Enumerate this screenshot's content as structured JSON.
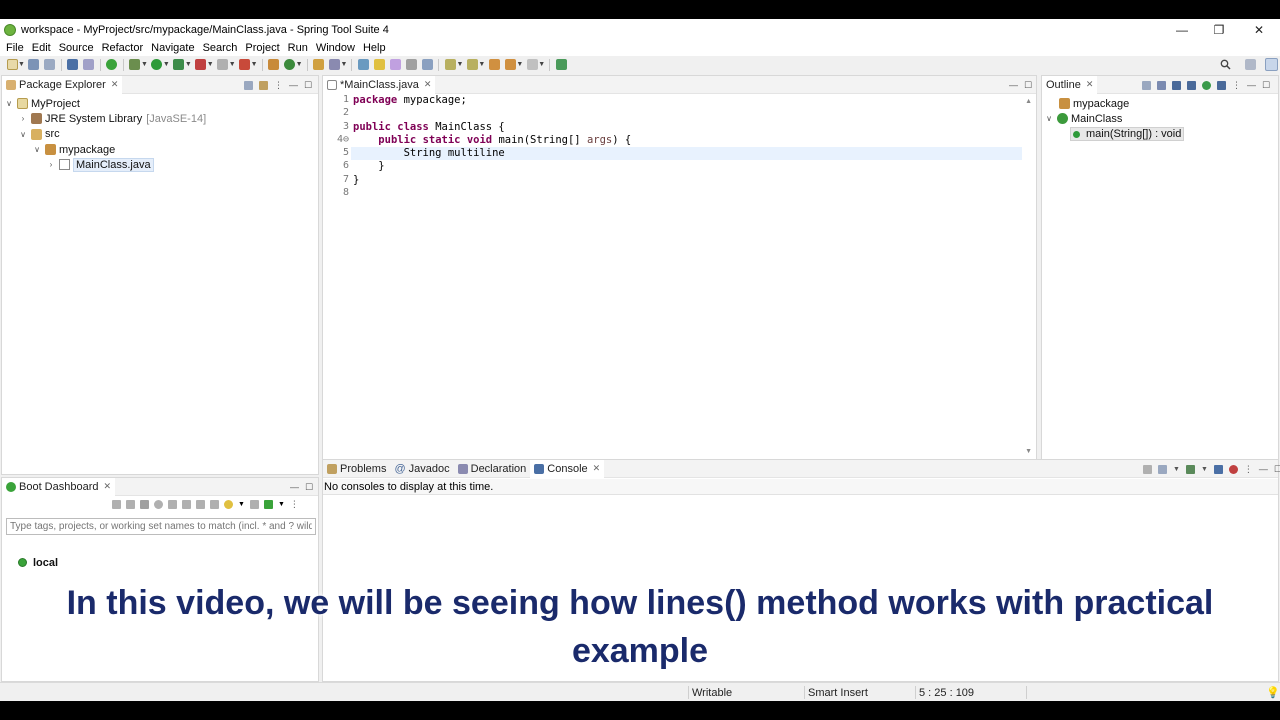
{
  "window": {
    "title": "workspace - MyProject/src/mypackage/MainClass.java - Spring Tool Suite 4",
    "controls": [
      "minimize",
      "restore",
      "close"
    ]
  },
  "menu": [
    "File",
    "Edit",
    "Source",
    "Refactor",
    "Navigate",
    "Search",
    "Project",
    "Run",
    "Window",
    "Help"
  ],
  "package_explorer": {
    "tab_label": "Package Explorer",
    "tree": {
      "project": "MyProject",
      "jre_label": "JRE System Library",
      "jre_version": "[JavaSE-14]",
      "src": "src",
      "package": "mypackage",
      "file": "MainClass.java"
    }
  },
  "editor": {
    "tab_label": "*MainClass.java",
    "line_numbers": [
      "1",
      "2",
      "3",
      "4⊖",
      "5",
      "6",
      "7",
      "8"
    ],
    "current_line": 5
  },
  "outline": {
    "tab_label": "Outline",
    "package": "mypackage",
    "class": "MainClass",
    "method": "main(String[]) : void"
  },
  "boot_dashboard": {
    "tab_label": "Boot Dashboard",
    "filter_placeholder": "Type tags, projects, or working set names to match (incl. * and ? wildc",
    "local_label": "local"
  },
  "bottom_panel": {
    "tabs": [
      "Problems",
      "Javadoc",
      "Declaration",
      "Console"
    ],
    "active_tab": "Console",
    "message": "No consoles to display at this time."
  },
  "status": {
    "writable": "Writable",
    "insert_mode": "Smart Insert",
    "position": "5 : 25 : 109"
  },
  "caption": {
    "line1": "In this video, we will be seeing how lines() method works with practical",
    "line2": "example"
  },
  "colors": {
    "keyword": "#7f0055",
    "param": "#6a3e3e",
    "caption": "#1a2a6b",
    "spring_green": "#6db33f"
  }
}
